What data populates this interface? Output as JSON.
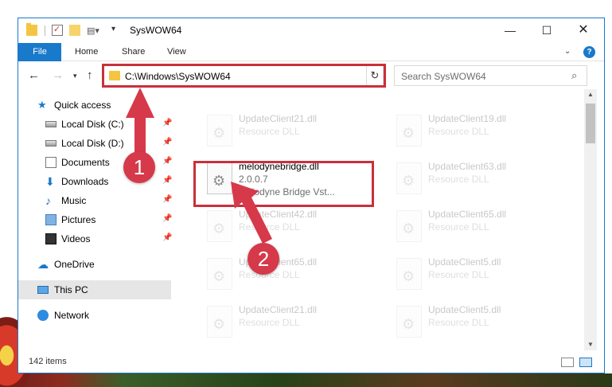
{
  "window": {
    "title": "SysWOW64",
    "minimize_glyph": "—",
    "maximize_glyph": "☐",
    "close_glyph": "✕"
  },
  "ribbon": {
    "file_label": "File",
    "home_label": "Home",
    "share_label": "Share",
    "view_label": "View",
    "help_glyph": "?"
  },
  "nav": {
    "address": "C:\\Windows\\SysWOW64",
    "search_placeholder": "Search SysWOW64"
  },
  "sidebar": {
    "items": [
      {
        "label": "Quick access",
        "icon": "star-icon",
        "pinned": false
      },
      {
        "label": "Local Disk (C:)",
        "icon": "drive-icon",
        "pinned": true
      },
      {
        "label": "Local Disk (D:)",
        "icon": "drive-icon",
        "pinned": true
      },
      {
        "label": "Documents",
        "icon": "documents-icon",
        "pinned": true
      },
      {
        "label": "Downloads",
        "icon": "download-icon",
        "pinned": true
      },
      {
        "label": "Music",
        "icon": "music-icon",
        "pinned": true
      },
      {
        "label": "Pictures",
        "icon": "pictures-icon",
        "pinned": true
      },
      {
        "label": "Videos",
        "icon": "videos-icon",
        "pinned": true
      },
      {
        "label": "OneDrive",
        "icon": "cloud-icon",
        "pinned": false
      },
      {
        "label": "This PC",
        "icon": "computer-icon",
        "pinned": false,
        "selected": true
      },
      {
        "label": "Network",
        "icon": "network-icon",
        "pinned": false
      }
    ]
  },
  "files": [
    {
      "name": "UpdateClient21.dll",
      "line1": "Resource DLL",
      "line2": "",
      "faded": true
    },
    {
      "name": "UpdateClient19.dll",
      "line1": "Resource DLL",
      "line2": "",
      "faded": true
    },
    {
      "name": "melodynebridge.dll",
      "line1": "2.0.0.7",
      "line2": "Melodyne Bridge Vst...",
      "faded": false
    },
    {
      "name": "UpdateClient63.dll",
      "line1": "Resource DLL",
      "line2": "",
      "faded": true
    },
    {
      "name": "UpdateClient42.dll",
      "line1": "Resource DLL",
      "line2": "",
      "faded": true
    },
    {
      "name": "UpdateClient65.dll",
      "line1": "Resource DLL",
      "line2": "",
      "faded": true
    },
    {
      "name": "UpdateClient65.dll",
      "line1": "Resource DLL",
      "line2": "",
      "faded": true
    },
    {
      "name": "UpdateClient5.dll",
      "line1": "Resource DLL",
      "line2": "",
      "faded": true
    },
    {
      "name": "UpdateClient21.dll",
      "line1": "Resource DLL",
      "line2": "",
      "faded": true
    },
    {
      "name": "UpdateClient5.dll",
      "line1": "Resource DLL",
      "line2": "",
      "faded": true
    }
  ],
  "status": {
    "item_count": "142 items"
  },
  "annotations": {
    "step1": "1",
    "step2": "2",
    "color": "#d6394a"
  },
  "colors": {
    "accent": "#1979ca",
    "highlight": "#c9303a"
  }
}
